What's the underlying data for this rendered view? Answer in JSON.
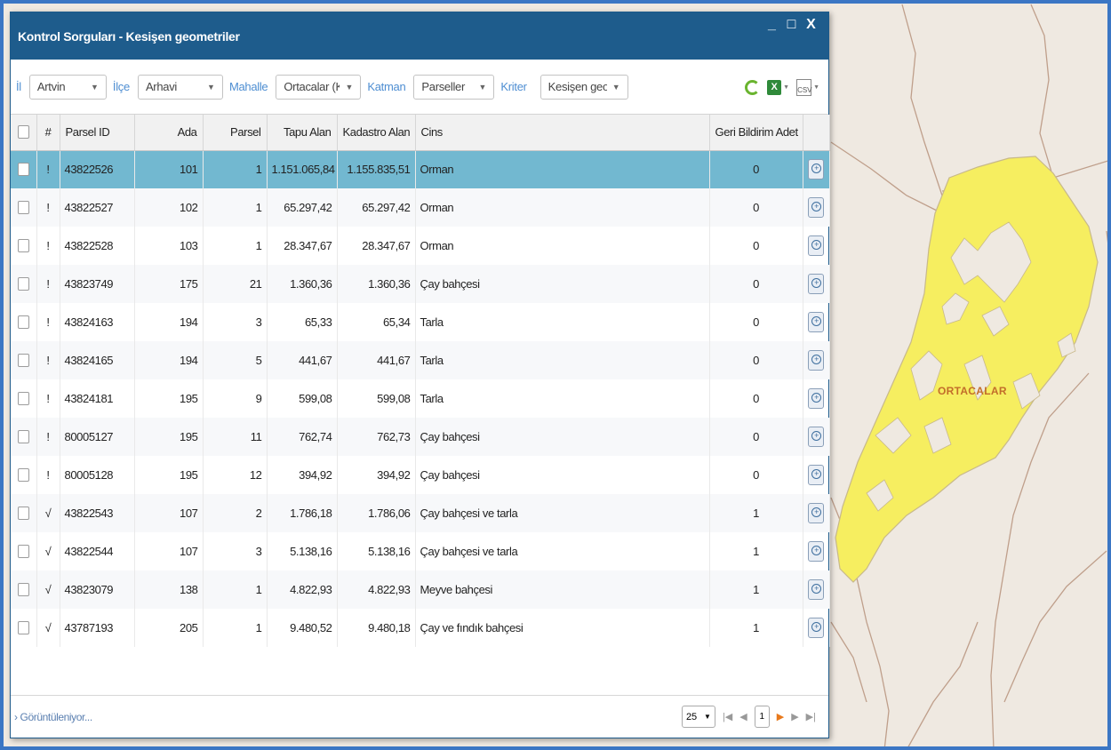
{
  "window": {
    "title": "Kontrol Sorguları - Kesişen geometriler",
    "buttons": {
      "minimize": "_",
      "maximize": "□",
      "close": "X"
    }
  },
  "toolbar": {
    "il_label": "İl",
    "il_value": "Artvin",
    "ilce_label": "İlçe",
    "ilce_value": "Arhavi",
    "mahalle_label": "Mahalle",
    "mahalle_value": "Ortacalar (K)",
    "katman_label": "Katman",
    "katman_value": "Parseller",
    "kriter_label": "Kriter",
    "kriter_value": "Kesişen geor",
    "csv_label": "CSV"
  },
  "grid": {
    "columns": [
      "#",
      "Parsel ID",
      "Ada",
      "Parsel",
      "Tapu Alan",
      "Kadastro Alan",
      "Cins",
      "Geri Bildirim Adet"
    ],
    "rows": [
      {
        "flag": "!",
        "parsel_id": "43822526",
        "ada": "101",
        "parsel": "1",
        "tapu": "1.151.065,84",
        "kadastro": "1.155.835,51",
        "cins": "Orman",
        "geri": "0"
      },
      {
        "flag": "!",
        "parsel_id": "43822527",
        "ada": "102",
        "parsel": "1",
        "tapu": "65.297,42",
        "kadastro": "65.297,42",
        "cins": "Orman",
        "geri": "0"
      },
      {
        "flag": "!",
        "parsel_id": "43822528",
        "ada": "103",
        "parsel": "1",
        "tapu": "28.347,67",
        "kadastro": "28.347,67",
        "cins": "Orman",
        "geri": "0"
      },
      {
        "flag": "!",
        "parsel_id": "43823749",
        "ada": "175",
        "parsel": "21",
        "tapu": "1.360,36",
        "kadastro": "1.360,36",
        "cins": "Çay bahçesi",
        "geri": "0"
      },
      {
        "flag": "!",
        "parsel_id": "43824163",
        "ada": "194",
        "parsel": "3",
        "tapu": "65,33",
        "kadastro": "65,34",
        "cins": "Tarla",
        "geri": "0"
      },
      {
        "flag": "!",
        "parsel_id": "43824165",
        "ada": "194",
        "parsel": "5",
        "tapu": "441,67",
        "kadastro": "441,67",
        "cins": "Tarla",
        "geri": "0"
      },
      {
        "flag": "!",
        "parsel_id": "43824181",
        "ada": "195",
        "parsel": "9",
        "tapu": "599,08",
        "kadastro": "599,08",
        "cins": "Tarla",
        "geri": "0"
      },
      {
        "flag": "!",
        "parsel_id": "80005127",
        "ada": "195",
        "parsel": "11",
        "tapu": "762,74",
        "kadastro": "762,73",
        "cins": "Çay bahçesi",
        "geri": "0"
      },
      {
        "flag": "!",
        "parsel_id": "80005128",
        "ada": "195",
        "parsel": "12",
        "tapu": "394,92",
        "kadastro": "394,92",
        "cins": "Çay bahçesi",
        "geri": "0"
      },
      {
        "flag": "√",
        "parsel_id": "43822543",
        "ada": "107",
        "parsel": "2",
        "tapu": "1.786,18",
        "kadastro": "1.786,06",
        "cins": "Çay bahçesi ve tarla",
        "geri": "1"
      },
      {
        "flag": "√",
        "parsel_id": "43822544",
        "ada": "107",
        "parsel": "3",
        "tapu": "5.138,16",
        "kadastro": "5.138,16",
        "cins": "Çay bahçesi ve tarla",
        "geri": "1"
      },
      {
        "flag": "√",
        "parsel_id": "43823079",
        "ada": "138",
        "parsel": "1",
        "tapu": "4.822,93",
        "kadastro": "4.822,93",
        "cins": "Meyve bahçesi",
        "geri": "1"
      },
      {
        "flag": "√",
        "parsel_id": "43787193",
        "ada": "205",
        "parsel": "1",
        "tapu": "9.480,52",
        "kadastro": "9.480,18",
        "cins": "Çay ve fındık bahçesi",
        "geri": "1"
      }
    ]
  },
  "footer": {
    "status": "› Görüntüleniyor...",
    "page_size": "25",
    "page": "1"
  },
  "map": {
    "label": "ORTACALAR",
    "fill_color": "#f6ee60",
    "border_color": "#b89a86"
  }
}
